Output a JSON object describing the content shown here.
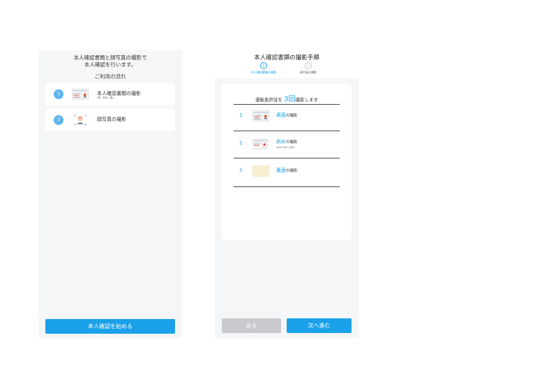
{
  "left_screen": {
    "intro_line1": "本人確認書類と顔写真の撮影で",
    "intro_line2": "本人確認を行います。",
    "flow_title": "ご利用の流れ",
    "steps": [
      {
        "number": "1",
        "label": "本人確認書類の撮影",
        "sub": "(表、斜め、裏)",
        "icon": "id-card-icon"
      },
      {
        "number": "2",
        "label": "顔写真の撮影",
        "icon": "face-photo-icon"
      }
    ],
    "start_button": "本人確認を始める"
  },
  "right_screen": {
    "title": "本人確認書類の撮影手順",
    "progress": [
      {
        "number": "1",
        "label": "本人確認書類の撮影",
        "active": true
      },
      {
        "number": "2",
        "label": "顔写真の撮影",
        "active": false
      }
    ],
    "plan_prefix": "運転免許証を",
    "plan_count": "3回",
    "plan_suffix": "撮影します",
    "rows": [
      {
        "number": "1",
        "highlight": "表面",
        "label": "の撮影",
        "sub": "",
        "icon": "license-front-icon"
      },
      {
        "number": "2",
        "highlight": "斜め",
        "label": "の撮影",
        "sub": "(斜め45度から撮影)",
        "icon": "license-angled-icon"
      },
      {
        "number": "3",
        "highlight": "裏面",
        "label": "の撮影",
        "sub": "",
        "icon": "license-back-icon"
      }
    ],
    "back_button": "戻る",
    "next_button": "次へ進む"
  },
  "colors": {
    "accent": "#1aa1ea",
    "step_circle": "#5fb6ef",
    "disabled_button": "#c8cacd",
    "screen_bg": "#f5f6f8"
  }
}
